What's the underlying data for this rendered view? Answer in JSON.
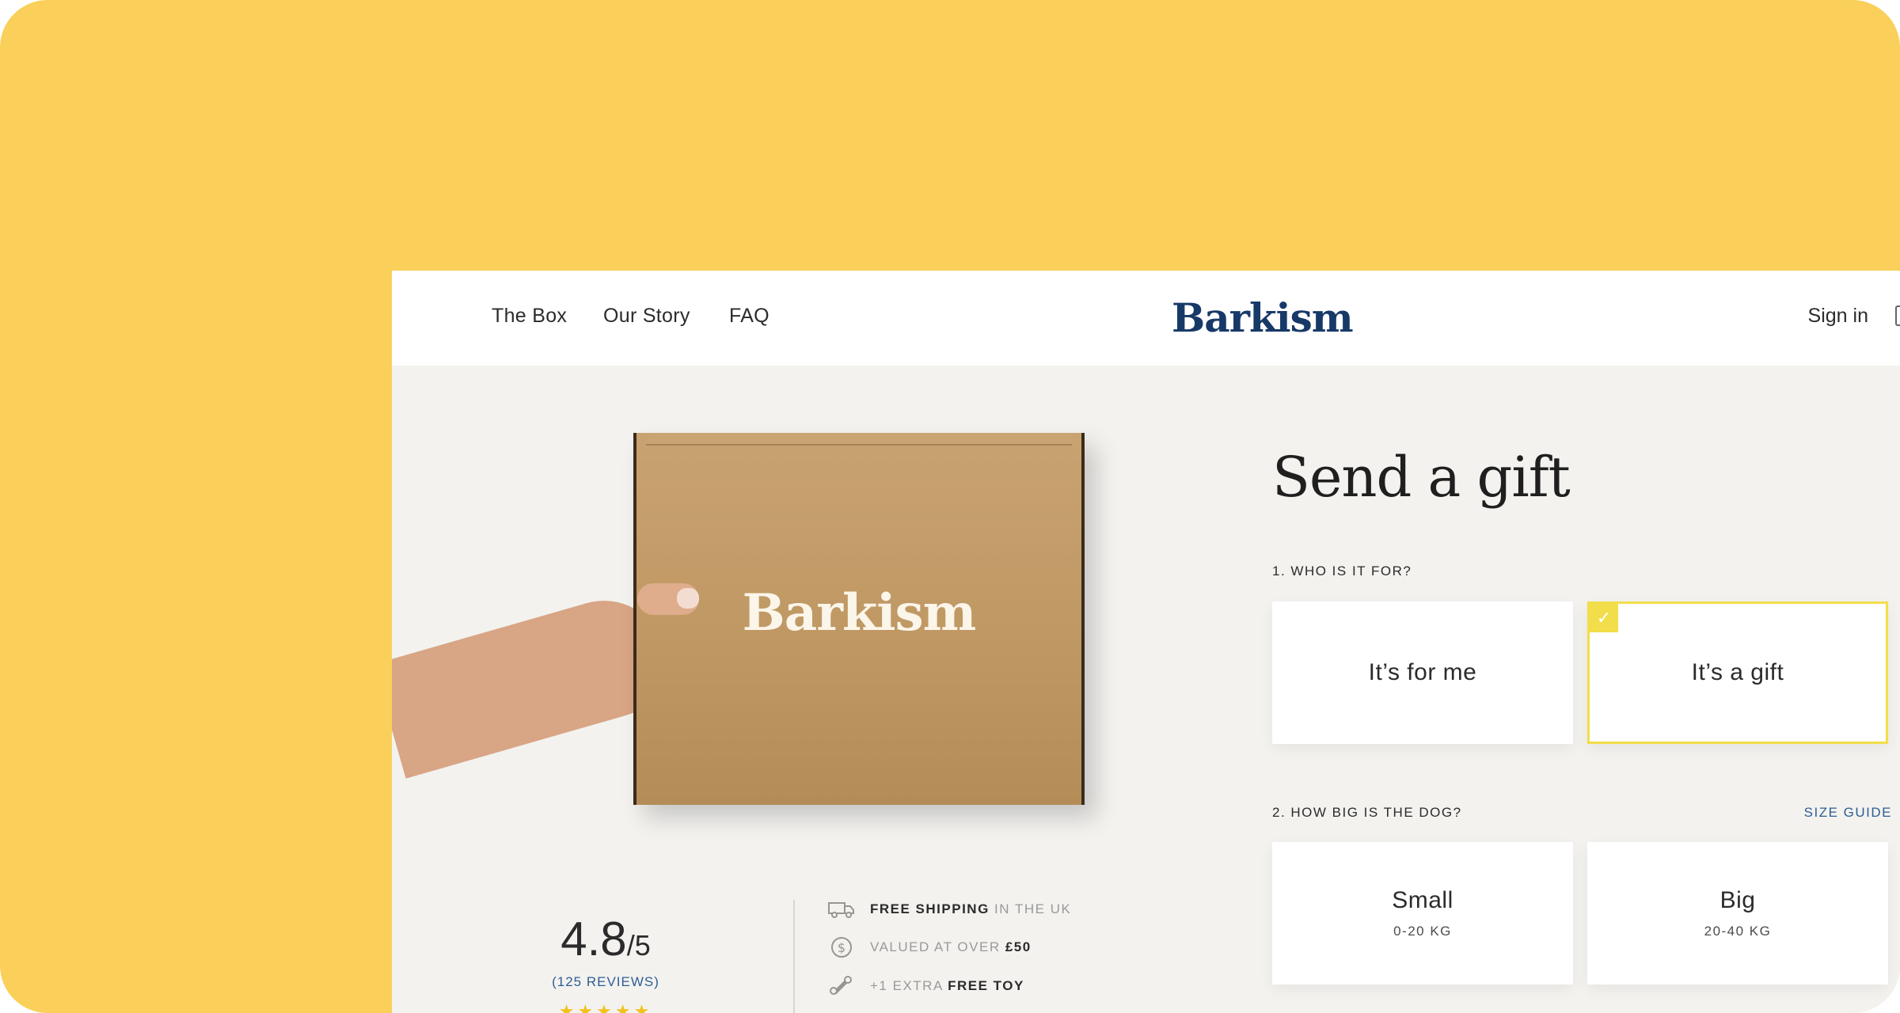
{
  "colors": {
    "background": "#fad05a",
    "brand_navy": "#173968",
    "accent_yellow": "#f2de4a",
    "link_blue": "#2e5d95",
    "page_bg": "#f3f2ef"
  },
  "nav": {
    "links": [
      "The Box",
      "Our Story",
      "FAQ"
    ],
    "logo": "Barkism",
    "sign_in": "Sign in"
  },
  "product": {
    "box_logo": "Barkism"
  },
  "rating": {
    "value": "4.8",
    "suffix": "/5",
    "reviews": "(125 REVIEWS)",
    "stars": "★★★★★"
  },
  "perks": [
    {
      "icon": "truck-icon",
      "bold": "FREE SHIPPING",
      "text": " IN THE UK"
    },
    {
      "icon": "dollar-coin-icon",
      "text": "VALUED AT OVER ",
      "bold": "£50"
    },
    {
      "icon": "bone-toy-icon",
      "text": "+1 EXTRA ",
      "bold": "FREE TOY"
    }
  ],
  "form": {
    "title": "Send a gift",
    "q1": "1. WHO IS IT FOR?",
    "q1_options": [
      {
        "label": "It’s for me",
        "selected": false
      },
      {
        "label": "It’s a gift",
        "selected": true
      }
    ],
    "q2": "2. HOW BIG IS THE DOG?",
    "size_guide": "SIZE GUIDE",
    "q2_options": [
      {
        "label": "Small",
        "sub": "0-20 KG"
      },
      {
        "label": "Big",
        "sub": "20-40 KG"
      }
    ],
    "check_icon": "check-icon"
  }
}
